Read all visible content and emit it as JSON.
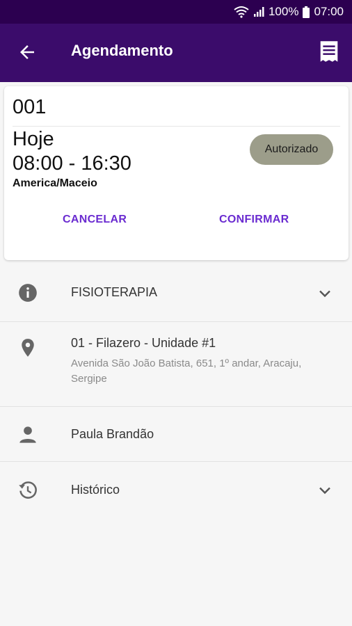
{
  "status_bar": {
    "battery": "100%",
    "time": "07:00"
  },
  "app_bar": {
    "title": "Agendamento",
    "back_icon": "arrow-left-icon",
    "action_icon": "receipt-icon"
  },
  "appointment": {
    "code": "001",
    "day": "Hoje",
    "time_range": "08:00 - 16:30",
    "timezone": "America/Maceio",
    "status": "Autorizado",
    "cancel_label": "CANCELAR",
    "confirm_label": "CONFIRMAR"
  },
  "details": {
    "service": {
      "label": "FISIOTERAPIA",
      "icon": "info-icon"
    },
    "location": {
      "name": "01 - Filazero - Unidade #1",
      "address": "Avenida São João Batista, 651, 1º andar, Aracaju, Sergipe",
      "icon": "location-pin-icon"
    },
    "person": {
      "name": "Paula Brandão",
      "icon": "person-icon"
    },
    "history": {
      "label": "Histórico",
      "icon": "history-icon"
    }
  },
  "colors": {
    "status_bar": "#2c0050",
    "app_bar": "#3b0c6b",
    "accent": "#6a2bd0",
    "badge": "#9c9d8a",
    "background": "#f6f6f6"
  }
}
